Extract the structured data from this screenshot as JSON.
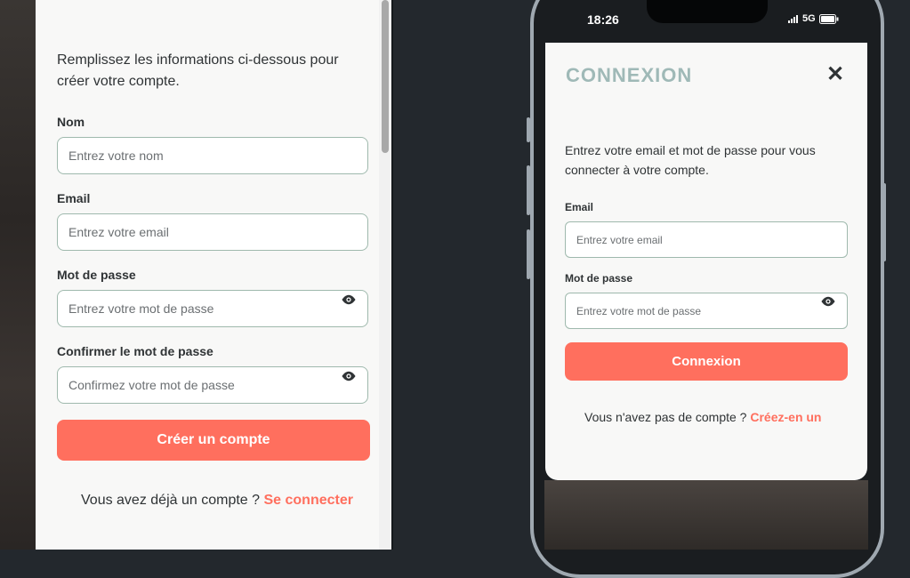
{
  "signup": {
    "intro": "Remplissez les informations ci-dessous pour créer votre compte.",
    "name_label": "Nom",
    "name_placeholder": "Entrez votre nom",
    "email_label": "Email",
    "email_placeholder": "Entrez votre email",
    "password_label": "Mot de passe",
    "password_placeholder": "Entrez votre mot de passe",
    "confirm_label": "Confirmer le mot de passe",
    "confirm_placeholder": "Confirmez votre mot de passe",
    "submit_label": "Créer un compte",
    "footer_text": "Vous avez déjà un compte ?",
    "footer_link": "Se connecter"
  },
  "phone": {
    "time": "18:26",
    "network": "5G"
  },
  "login": {
    "title": "CONNEXION",
    "close_symbol": "✕",
    "intro": "Entrez votre email et mot de passe pour vous connecter à votre compte.",
    "email_label": "Email",
    "email_placeholder": "Entrez votre email",
    "password_label": "Mot de passe",
    "password_placeholder": "Entrez votre mot de passe",
    "submit_label": "Connexion",
    "footer_text": "Vous n'avez pas de compte ?",
    "footer_link": "Créez-en un"
  },
  "colors": {
    "accent": "#ff6f5e",
    "title": "#9fb9b7",
    "input_border": "#9fb9ad"
  }
}
